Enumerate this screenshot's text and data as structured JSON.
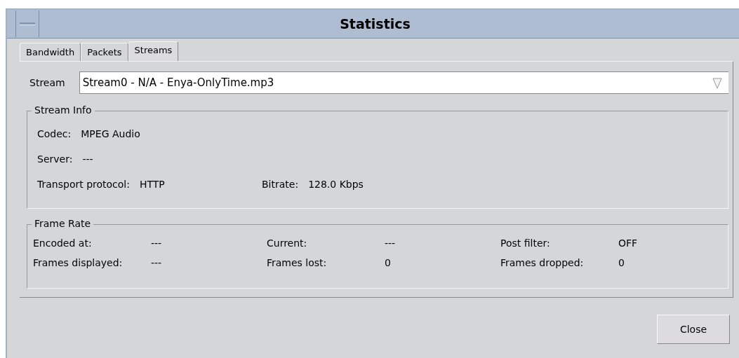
{
  "window": {
    "title": "Statistics"
  },
  "tabs": [
    {
      "label": "Bandwidth",
      "selected": false
    },
    {
      "label": "Packets",
      "selected": false
    },
    {
      "label": "Streams",
      "selected": true
    }
  ],
  "stream": {
    "label": "Stream",
    "value": "Stream0 - N/A - Enya-OnlyTime.mp3"
  },
  "stream_info": {
    "title": "Stream Info",
    "rows": [
      [
        {
          "label": "Codec:",
          "value": "MPEG Audio"
        }
      ],
      [
        {
          "label": "Server:",
          "value": "---"
        }
      ],
      [
        {
          "label": "Transport protocol:",
          "value": "HTTP"
        },
        {
          "label": "Bitrate:",
          "value": "128.0 Kbps"
        }
      ]
    ]
  },
  "frame_rate": {
    "title": "Frame Rate",
    "items": [
      {
        "label": "Encoded at:",
        "value": "---"
      },
      {
        "label": "Current:",
        "value": "---"
      },
      {
        "label": "Post filter:",
        "value": "OFF"
      },
      {
        "label": "Frames displayed:",
        "value": "---"
      },
      {
        "label": "Frames lost:",
        "value": "0"
      },
      {
        "label": "Frames dropped:",
        "value": "0"
      }
    ]
  },
  "buttons": [
    "Close"
  ]
}
